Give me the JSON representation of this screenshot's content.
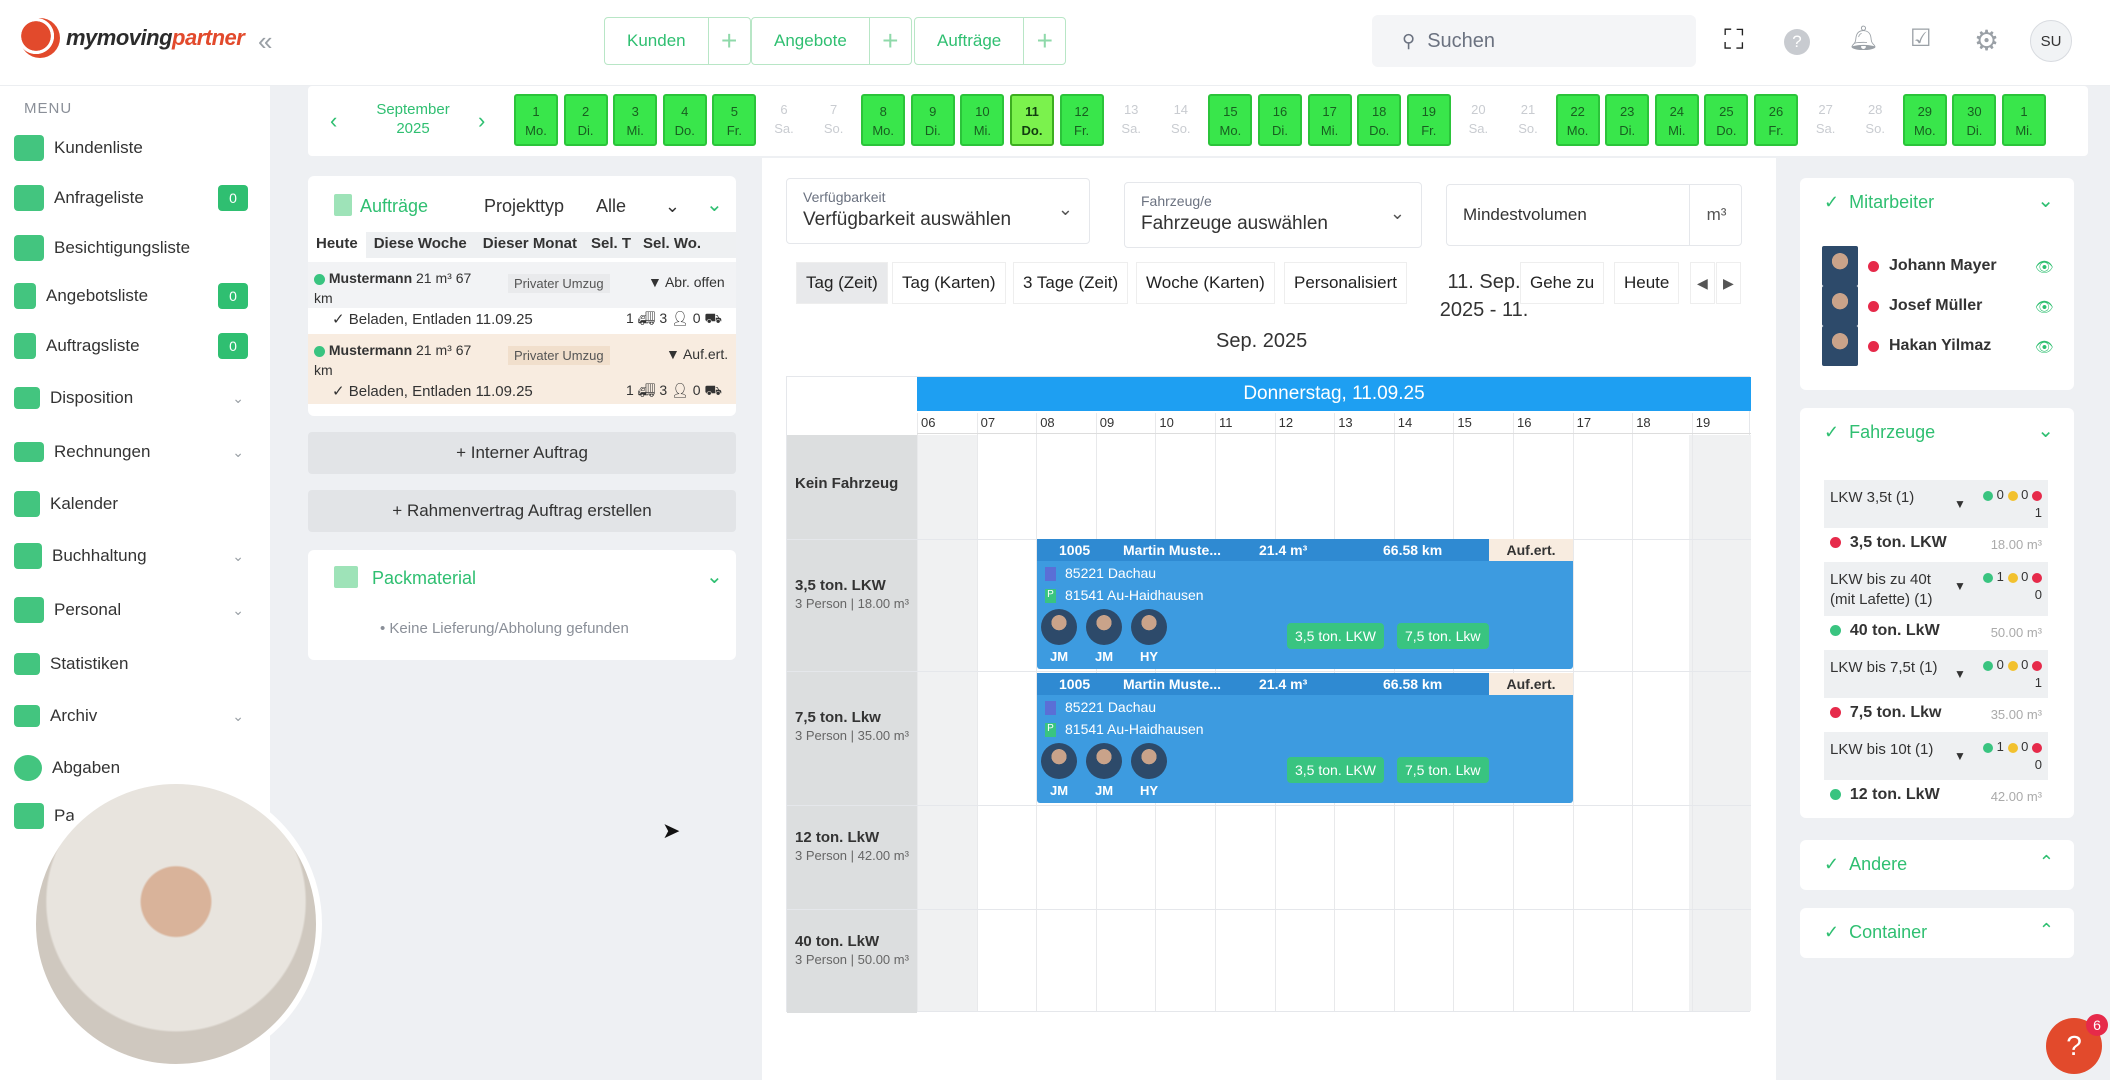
{
  "brand": {
    "name_pre": "my",
    "name_mid": "moving",
    "name_post": "partner"
  },
  "header": {
    "pills": [
      {
        "label": "Kunden"
      },
      {
        "label": "Angebote"
      },
      {
        "label": "Aufträge"
      }
    ],
    "search_placeholder": "Suchen",
    "user_initials": "SU"
  },
  "sidebar": {
    "menu_label": "MENU",
    "items": [
      {
        "label": "Kundenliste"
      },
      {
        "label": "Anfrageliste",
        "badge": "0"
      },
      {
        "label": "Besichtigungsliste"
      },
      {
        "label": "Angebotsliste",
        "badge": "0"
      },
      {
        "label": "Auftragsliste",
        "badge": "0"
      },
      {
        "label": "Disposition"
      },
      {
        "label": "Rechnungen"
      },
      {
        "label": "Kalender"
      },
      {
        "label": "Buchhaltung"
      },
      {
        "label": "Personal"
      },
      {
        "label": "Statistiken"
      },
      {
        "label": "Archiv"
      },
      {
        "label": "Abgaben"
      },
      {
        "label": "Pa"
      }
    ]
  },
  "datebar": {
    "month": "September",
    "year": "2025",
    "days": [
      {
        "n": "1",
        "d": "Mo.",
        "t": "work"
      },
      {
        "n": "2",
        "d": "Di.",
        "t": "work"
      },
      {
        "n": "3",
        "d": "Mi.",
        "t": "work"
      },
      {
        "n": "4",
        "d": "Do.",
        "t": "work"
      },
      {
        "n": "5",
        "d": "Fr.",
        "t": "work"
      },
      {
        "n": "6",
        "d": "Sa.",
        "t": "off"
      },
      {
        "n": "7",
        "d": "So.",
        "t": "off"
      },
      {
        "n": "8",
        "d": "Mo.",
        "t": "work"
      },
      {
        "n": "9",
        "d": "Di.",
        "t": "work"
      },
      {
        "n": "10",
        "d": "Mi.",
        "t": "work"
      },
      {
        "n": "11",
        "d": "Do.",
        "t": "today"
      },
      {
        "n": "12",
        "d": "Fr.",
        "t": "work"
      },
      {
        "n": "13",
        "d": "Sa.",
        "t": "off"
      },
      {
        "n": "14",
        "d": "So.",
        "t": "off"
      },
      {
        "n": "15",
        "d": "Mo.",
        "t": "work"
      },
      {
        "n": "16",
        "d": "Di.",
        "t": "work"
      },
      {
        "n": "17",
        "d": "Mi.",
        "t": "work"
      },
      {
        "n": "18",
        "d": "Do.",
        "t": "work"
      },
      {
        "n": "19",
        "d": "Fr.",
        "t": "work"
      },
      {
        "n": "20",
        "d": "Sa.",
        "t": "off"
      },
      {
        "n": "21",
        "d": "So.",
        "t": "off"
      },
      {
        "n": "22",
        "d": "Mo.",
        "t": "work"
      },
      {
        "n": "23",
        "d": "Di.",
        "t": "work"
      },
      {
        "n": "24",
        "d": "Mi.",
        "t": "work"
      },
      {
        "n": "25",
        "d": "Do.",
        "t": "work"
      },
      {
        "n": "26",
        "d": "Fr.",
        "t": "work"
      },
      {
        "n": "27",
        "d": "Sa.",
        "t": "off"
      },
      {
        "n": "28",
        "d": "So.",
        "t": "off"
      },
      {
        "n": "29",
        "d": "Mo.",
        "t": "work"
      },
      {
        "n": "30",
        "d": "Di.",
        "t": "work"
      },
      {
        "n": "1",
        "d": "Mi.",
        "t": "work"
      }
    ]
  },
  "orders": {
    "title": "Aufträge",
    "filter_label": "Projekttyp",
    "filter_value": "Alle",
    "tabs": [
      "Heute",
      "Diese Woche",
      "Dieser Monat",
      "Sel. T",
      "Sel. Wo."
    ],
    "rows": [
      {
        "name": "Mustermann",
        "vol": "21 m³",
        "dist": "67",
        "unit": "km",
        "type": "Privater Umzug",
        "status": "▼ Abr. offen",
        "detail": "✓ Beladen, Entladen 11.09.25",
        "c1": "1",
        "c2": "3",
        "c3": "0"
      },
      {
        "name": "Mustermann",
        "vol": "21 m³",
        "dist": "67",
        "unit": "km",
        "type": "Privater Umzug",
        "status": "▼ Auf.ert.",
        "detail": "✓ Beladen, Entladen 11.09.25",
        "c1": "1",
        "c2": "3",
        "c3": "0"
      }
    ],
    "btn_internal": "+ Interner Auftrag",
    "btn_frame": "+ Rahmenvertrag Auftrag erstellen"
  },
  "pack": {
    "title": "Packmaterial",
    "empty": "• Keine Lieferung/Abholung gefunden"
  },
  "filters": {
    "avail_small": "Verfügbarkeit",
    "avail_big": "Verfügbarkeit auswählen",
    "veh_small": "Fahrzeug/e",
    "veh_big": "Fahrzeuge auswählen",
    "minvol": "Mindestvolumen",
    "unit": "m³"
  },
  "views": [
    "Tag (Zeit)",
    "Tag (Karten)",
    "3 Tage (Zeit)",
    "Woche (Karten)",
    "Personalisiert"
  ],
  "range_line1": "11. Sep.",
  "range_line2": "2025 - 11.",
  "range_line3": "Sep. 2025",
  "goto": "Gehe zu",
  "today": "Heute",
  "calendar": {
    "day_header": "Donnerstag, 11.09.25",
    "hours": [
      "06",
      "07",
      "08",
      "09",
      "10",
      "11",
      "12",
      "13",
      "14",
      "15",
      "16",
      "17",
      "18",
      "19"
    ],
    "resources": [
      {
        "name": "Kein Fahrzeug",
        "sub": ""
      },
      {
        "name": "3,5 ton. LKW",
        "sub": "3 Person | 18.00 m³"
      },
      {
        "name": "7,5 ton. Lkw",
        "sub": "3 Person | 35.00 m³"
      },
      {
        "name": "12 ton. LkW",
        "sub": "3 Person | 42.00 m³"
      },
      {
        "name": "40 ton. LkW",
        "sub": "3 Person | 50.00 m³"
      }
    ],
    "events": [
      {
        "id": "1005",
        "name": "Martin Muste...",
        "vol": "21.4 m³",
        "km": "66.58 km",
        "status": "Auf.ert.",
        "from": "85221 Dachau",
        "to": "81541 Au-Haidhausen",
        "staff": [
          "JM",
          "JM",
          "HY"
        ],
        "tags": [
          "3,5 ton. LKW",
          "7,5 ton. Lkw"
        ]
      },
      {
        "id": "1005",
        "name": "Martin Muste...",
        "vol": "21.4 m³",
        "km": "66.58 km",
        "status": "Auf.ert.",
        "from": "85221 Dachau",
        "to": "81541 Au-Haidhausen",
        "staff": [
          "JM",
          "JM",
          "HY"
        ],
        "tags": [
          "3,5 ton. LKW",
          "7,5 ton. Lkw"
        ]
      }
    ]
  },
  "employees": {
    "title": "Mitarbeiter",
    "list": [
      "Johann Mayer",
      "Josef Müller",
      "Hakan Yilmaz"
    ]
  },
  "vehicles": {
    "title": "Fahrzeuge",
    "groups": [
      {
        "g": "LKW 3,5t (1)",
        "c": [
          "0",
          "0",
          "1"
        ],
        "item": "3,5 ton. LKW",
        "vol": "18.00 m³",
        "dot": "#e62a4a"
      },
      {
        "g": "LKW bis zu 40t (mit Lafette) (1)",
        "c": [
          "1",
          "0",
          "0"
        ],
        "item": "40 ton. LkW",
        "vol": "50.00 m³",
        "dot": "#39c480"
      },
      {
        "g": "LKW bis 7,5t (1)",
        "c": [
          "0",
          "0",
          "1"
        ],
        "item": "7,5 ton. Lkw",
        "vol": "35.00 m³",
        "dot": "#e62a4a"
      },
      {
        "g": "LKW bis 10t (1)",
        "c": [
          "1",
          "0",
          "0"
        ],
        "item": "12 ton. LkW",
        "vol": "42.00 m³",
        "dot": "#39c480"
      }
    ]
  },
  "other": {
    "title": "Andere"
  },
  "container": {
    "title": "Container"
  },
  "help_badge": "6",
  "colors": {
    "accent": "#2fbf71",
    "event": "#3d9be0",
    "header_blue": "#1e9ff2",
    "workday": "#39e64b"
  }
}
